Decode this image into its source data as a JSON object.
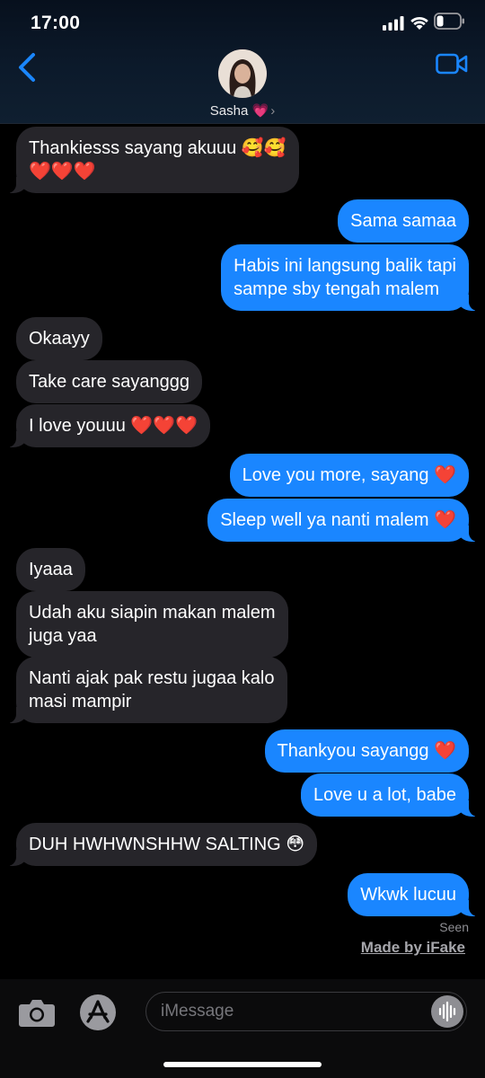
{
  "status_bar": {
    "time": "17:00"
  },
  "header": {
    "contact_name": "Sasha 💗",
    "chevron": "›",
    "icons": {
      "back": "chevron-left-icon",
      "video": "video-camera-icon"
    },
    "accent": "#1a86ff"
  },
  "messages": [
    {
      "dir": "in",
      "lines": [
        "Thankiesss sayang akuuu 🥰🥰",
        "❤️❤️❤️"
      ]
    },
    {
      "dir": "out",
      "lines": [
        "Sama samaa"
      ]
    },
    {
      "dir": "out",
      "lines": [
        "Habis ini langsung balik tapi",
        "sampe sby tengah malem"
      ]
    },
    {
      "dir": "in",
      "lines": [
        "Okaayy"
      ]
    },
    {
      "dir": "in",
      "lines": [
        "Take care sayanggg"
      ]
    },
    {
      "dir": "in",
      "lines": [
        "I love youuu ❤️❤️❤️"
      ]
    },
    {
      "dir": "out",
      "lines": [
        "Love you more, sayang ❤️"
      ]
    },
    {
      "dir": "out",
      "lines": [
        "Sleep well ya nanti malem ❤️"
      ]
    },
    {
      "dir": "in",
      "lines": [
        "Iyaaa"
      ]
    },
    {
      "dir": "in",
      "lines": [
        "Udah aku siapin makan malem",
        "juga yaa"
      ]
    },
    {
      "dir": "in",
      "lines": [
        "Nanti ajak pak restu jugaa kalo",
        "masi mampir"
      ]
    },
    {
      "dir": "out",
      "lines": [
        "Thankyou sayangg ❤️"
      ]
    },
    {
      "dir": "out",
      "lines": [
        "Love u a lot, babe"
      ]
    },
    {
      "dir": "in",
      "lines": [
        "DUH HWHWNSHHW SALTING 😳"
      ]
    },
    {
      "dir": "out",
      "lines": [
        "Wkwk lucuu"
      ]
    }
  ],
  "receipt": "Seen",
  "watermark": "Made by iFake",
  "input_bar": {
    "placeholder": "iMessage",
    "icons": {
      "camera": "camera-icon",
      "apps": "app-store-icon",
      "audio": "audio-waveform-icon"
    }
  },
  "colors": {
    "incoming_bubble": "#26252a",
    "outgoing_bubble": "#1a86ff",
    "background": "#000000"
  }
}
